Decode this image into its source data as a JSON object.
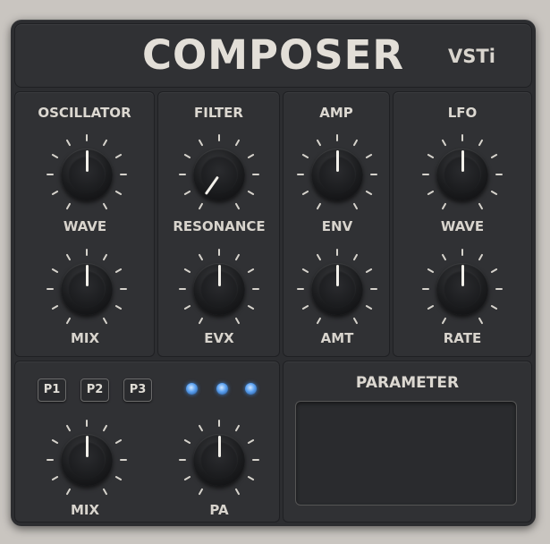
{
  "header": {
    "title": "COMPOSER",
    "subtitle": "VSTi"
  },
  "sections": {
    "oscillator": {
      "title": "OSCILLATOR",
      "knobs": [
        {
          "label": "WAVE"
        },
        {
          "label": "MIX"
        }
      ]
    },
    "filter": {
      "title": "FILTER",
      "knobs": [
        {
          "label": "RESONANCE"
        },
        {
          "label": "EVX"
        }
      ]
    },
    "amp": {
      "title": "AMP",
      "knobs": [
        {
          "label": "ENV"
        },
        {
          "label": "AMT"
        }
      ]
    },
    "lfo": {
      "title": "LFO",
      "knobs": [
        {
          "label": "WAVE"
        },
        {
          "label": "RATE"
        }
      ]
    }
  },
  "presets": {
    "buttons": [
      "P1",
      "P2",
      "P3"
    ],
    "knobs": [
      {
        "label": "MIX"
      },
      {
        "label": "PA"
      }
    ]
  },
  "parameter": {
    "title": "PARAMETER"
  },
  "colors": {
    "panel": "#2c2d30",
    "text": "#e3dfd8",
    "led": "#5aa0f0",
    "background": "#c9c5c0"
  }
}
